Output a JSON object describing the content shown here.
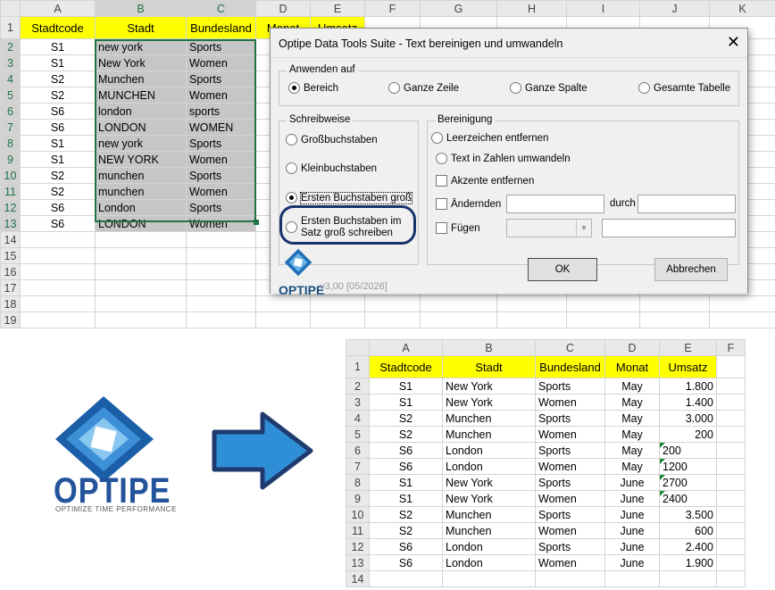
{
  "top_sheet": {
    "col_headers": [
      "A",
      "B",
      "C",
      "D",
      "E",
      "F",
      "G",
      "H",
      "I",
      "J",
      "K"
    ],
    "row_numbers": [
      "1",
      "2",
      "3",
      "4",
      "5",
      "6",
      "7",
      "8",
      "9",
      "10",
      "11",
      "12",
      "13",
      "14",
      "15",
      "16",
      "17",
      "18",
      "19"
    ],
    "header_row": [
      "Stadtcode",
      "Stadt",
      "Bundesland",
      "Monat",
      "Umsatz"
    ],
    "rows": [
      [
        "S1",
        "new york",
        "Sports"
      ],
      [
        "S1",
        "New York",
        "Women"
      ],
      [
        "S2",
        "Munchen",
        "Sports"
      ],
      [
        "S2",
        "MUNCHEN",
        "Women"
      ],
      [
        "S6",
        "london",
        "sports"
      ],
      [
        "S6",
        "LONDON",
        "WOMEN"
      ],
      [
        "S1",
        "new york",
        "Sports"
      ],
      [
        "S1",
        "NEW YORK",
        "Women"
      ],
      [
        "S2",
        "munchen",
        "Sports"
      ],
      [
        "S2",
        "munchen",
        "Women"
      ],
      [
        "S6",
        "London",
        "Sports"
      ],
      [
        "S6",
        "LONDON",
        "Women"
      ]
    ]
  },
  "dialog": {
    "title": "Optipe Data Tools Suite - Text bereinigen und umwandeln",
    "apply_group": "Anwenden auf",
    "apply_options": [
      "Bereich",
      "Ganze Zeile",
      "Ganze Spalte",
      "Gesamte Tabelle"
    ],
    "apply_selected": "Bereich",
    "case_group": "Schreibweise",
    "case_options": [
      "Großbuchstaben",
      "Kleinbuchstaben",
      "Ersten Buchstaben groß",
      "Ersten Buchstaben im",
      "Satz groß schreiben"
    ],
    "case_selected": "Ersten Buchstaben groß",
    "clean_group": "Bereinigung",
    "clean_options": [
      "Leerzeichen entfernen",
      "Text in Zahlen umwandeln",
      "Akzente entfernen",
      "Ändernden",
      "Fügen"
    ],
    "durch_label": "durch",
    "ok_label": "OK",
    "cancel_label": "Abbrechen",
    "brand": "OPTIPE",
    "version": "v3,00 [05/2026]"
  },
  "logo": {
    "brand": "OPTIPE",
    "tagline": "OPTIMIZE TIME PERFORMANCE"
  },
  "result_sheet": {
    "col_headers": [
      "A",
      "B",
      "C",
      "D",
      "E",
      "F"
    ],
    "row_numbers": [
      "1",
      "2",
      "3",
      "4",
      "5",
      "6",
      "7",
      "8",
      "9",
      "10",
      "11",
      "12",
      "13",
      "14"
    ],
    "header_row": [
      "Stadtcode",
      "Stadt",
      "Bundesland",
      "Monat",
      "Umsatz"
    ],
    "rows": [
      [
        "S1",
        "New York",
        "Sports",
        "May",
        "1.800"
      ],
      [
        "S1",
        "New York",
        "Women",
        "May",
        "1.400"
      ],
      [
        "S2",
        "Munchen",
        "Sports",
        "May",
        "3.000"
      ],
      [
        "S2",
        "Munchen",
        "Women",
        "May",
        "200"
      ],
      [
        "S6",
        "London",
        "Sports",
        "May",
        "200"
      ],
      [
        "S6",
        "London",
        "Women",
        "May",
        "1200"
      ],
      [
        "S1",
        "New York",
        "Sports",
        "June",
        "2700"
      ],
      [
        "S1",
        "New York",
        "Women",
        "June",
        "2400"
      ],
      [
        "S2",
        "Munchen",
        "Sports",
        "June",
        "3.500"
      ],
      [
        "S2",
        "Munchen",
        "Women",
        "June",
        "600"
      ],
      [
        "S6",
        "London",
        "Sports",
        "June",
        "2.400"
      ],
      [
        "S6",
        "London",
        "Women",
        "June",
        "1.900"
      ]
    ]
  },
  "colors": {
    "header_yellow": "#ffff00",
    "selection_gray": "#c6c6c6",
    "accent_blue": "#23539b",
    "arrow_blue": "#2f8fd6"
  }
}
